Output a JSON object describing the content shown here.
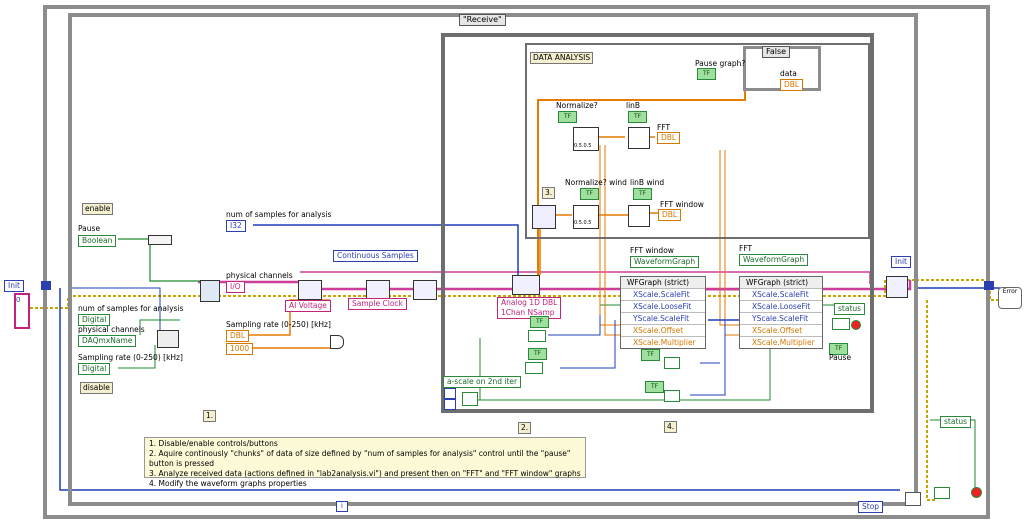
{
  "selectors": {
    "outer_case": "\"Receive\"",
    "pause_case": "False"
  },
  "shift_init": "Init",
  "shift_init_right": "Init",
  "stop_button": "Stop",
  "error_label": "Error",
  "init_left_value": "0",
  "frame": {
    "data_analysis_title": "DATA ANALYSIS"
  },
  "left_panel": {
    "enable_tag": "enable",
    "disable_tag": "disable",
    "pause_label": "Pause",
    "pause_ctl": "Boolean",
    "samples_label": "num of samples for analysis",
    "samples_ctl": "Digital",
    "channels_label": "physical channels",
    "channels_ctl": "DAQmxName",
    "rate_label": "Sampling rate (0-250) [kHz]",
    "rate_ctl": "Digital"
  },
  "acq": {
    "samples_label": "num of samples for analysis",
    "samples_ctl": "I32",
    "channels_label": "physical channels",
    "channels_ctl": "I/O",
    "continuous": "Continuous Samples",
    "ai_voltage": "AI Voltage",
    "sample_clock": "Sample Clock",
    "rate_label": "Sampling rate (0-250) [kHz]",
    "rate_ctl": "DBL",
    "thousand": "1000",
    "analog_read": "Analog 1D DBL\n1Chan NSamp"
  },
  "analysis": {
    "pause_graph_label": "Pause graph?",
    "data_label": "data",
    "normalize_label": "Normalize?",
    "linb_label": "linB",
    "fft_label": "FFT",
    "normalize_wind_label": "Normalize? wind",
    "linb_wind_label": "linB wind",
    "fft_window_label": "FFT window",
    "step3": "3.",
    "tf": "TF",
    "dbl": "DBL",
    "ind_value": "0.5.0.5"
  },
  "graphs": {
    "fft_window_label": "FFT window",
    "fft_window_ref": "WaveformGraph",
    "fft_label": "FFT",
    "fft_ref": "WaveformGraph",
    "prop_node_1": "WFGraph (strict)",
    "prop_node_2": "WFGraph (strict)",
    "props_1": [
      "XScale.ScaleFit",
      "XScale.LooseFit",
      "YScale.ScaleFit",
      "XScale.Offset",
      "XScale.Multiplier"
    ],
    "props_2": [
      "XScale.ScaleFit",
      "XScale.LooseFit",
      "YScale.ScaleFit",
      "XScale.Offset",
      "XScale.Multiplier"
    ],
    "status_label": "status",
    "pause_label": "Pause",
    "status_bottom": "status",
    "ascale_label": "a-scale on 2nd iter"
  },
  "steps": {
    "s1": "1.",
    "s2": "2.",
    "s4": "4.",
    "iteration": "i"
  },
  "notes": [
    "1. Disable/enable controls/buttons",
    "2. Aquire continously \"chunks\" of data of size defined by \"num of samples for analysis\" control until the \"pause\" button is pressed",
    "3. Analyze received data (actions defined in \"lab2analysis.vi\") and present then on \"FFT\" and \"FFT window\" graphs",
    "4. Modify the waveform graphs properties"
  ],
  "colors": {
    "wire_pink": "#cc3e97",
    "wire_blue": "#1f3fb8",
    "wire_orange": "#e57a00",
    "wire_green": "#1e8a32",
    "wire_yellow": "#c9a300",
    "frame_gray": "#8c8c8c"
  }
}
